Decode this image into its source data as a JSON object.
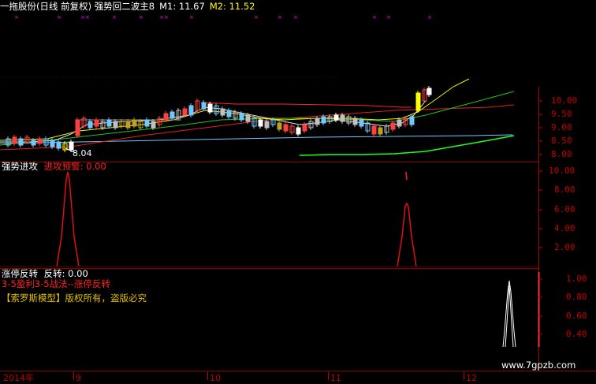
{
  "header": {
    "title": "一拖股份(日线 前复权) 强势回二波主8",
    "m1": "M1: 11.67",
    "m2": "M2: 11.52"
  },
  "top_panel": {
    "low_label": "8.04",
    "y_ticks": [
      "10.00",
      "9.50",
      "9.00",
      "8.50",
      "8.00"
    ]
  },
  "mid_panel": {
    "indicator_name": "强势进攻",
    "indicator_value": "进攻预警: 0.00",
    "y_ticks": [
      "10.00",
      "8.00",
      "6.00",
      "4.00",
      "2.00"
    ]
  },
  "bottom_panel": {
    "indicator_name": "涨停反转",
    "indicator_value": "反转: 0.00",
    "line1": "3-5盈利3-5战法--涨停反转",
    "line2": "【索罗斯模型】版权所有，盗版必究",
    "y_ticks": [
      "1.00",
      "0.80",
      "0.60",
      "0.40"
    ]
  },
  "x_axis": {
    "labels": [
      "2014年",
      "9",
      "10",
      "11",
      "12"
    ]
  },
  "watermark": "www.7gpzb.com",
  "colors": {
    "background": "#000000",
    "axis": "#c00000",
    "yellow": "#ffff00",
    "cyan": "#00ffff",
    "green": "#00ff00",
    "red": "#ff0000",
    "magenta": "#ff00ff"
  }
}
